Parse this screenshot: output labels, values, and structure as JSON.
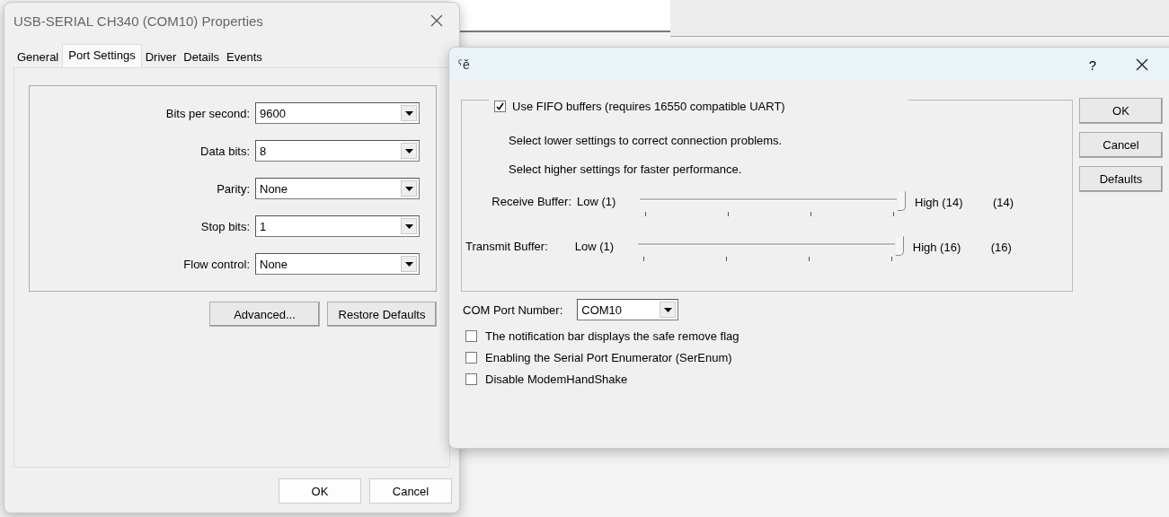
{
  "properties_dialog": {
    "title": "USB-SERIAL CH340 (COM10) Properties",
    "tabs": [
      {
        "label": "General",
        "selected": false
      },
      {
        "label": "Port Settings",
        "selected": true
      },
      {
        "label": "Driver",
        "selected": false
      },
      {
        "label": "Details",
        "selected": false
      },
      {
        "label": "Events",
        "selected": false
      }
    ],
    "fields": [
      {
        "label": "Bits per second:",
        "value": "9600"
      },
      {
        "label": "Data bits:",
        "value": "8"
      },
      {
        "label": "Parity:",
        "value": "None"
      },
      {
        "label": "Stop bits:",
        "value": "1"
      },
      {
        "label": "Flow control:",
        "value": "None"
      }
    ],
    "buttons": [
      "Advanced...",
      "Restore Defaults"
    ],
    "footer_buttons": [
      "OK",
      "Cancel"
    ]
  },
  "advanced_dialog": {
    "title": "ˁě",
    "help": "?",
    "fifo": {
      "label": "Use FIFO buffers (requires 16550 compatible UART)",
      "checked": true
    },
    "notes": [
      "Select lower settings to correct connection problems.",
      "Select higher settings for faster performance."
    ],
    "sliders": [
      {
        "label": "Receive Buffer:",
        "low": "Low (1)",
        "high": "High (14)",
        "reading": "(14)",
        "level": 1
      },
      {
        "label": "Transmit Buffer:",
        "low": "Low (1)",
        "high": "High (16)",
        "reading": "(16)",
        "level": 1
      }
    ],
    "com_port": {
      "label": "COM Port Number:",
      "value": "COM10"
    },
    "options": [
      {
        "label": "The notification bar displays the safe remove flag",
        "checked": false
      },
      {
        "label": "Enabling the Serial Port Enumerator (SerEnum)",
        "checked": false
      },
      {
        "label": "Disable ModemHandShake",
        "checked": false
      }
    ],
    "buttons": [
      "OK",
      "Cancel",
      "Defaults"
    ]
  }
}
